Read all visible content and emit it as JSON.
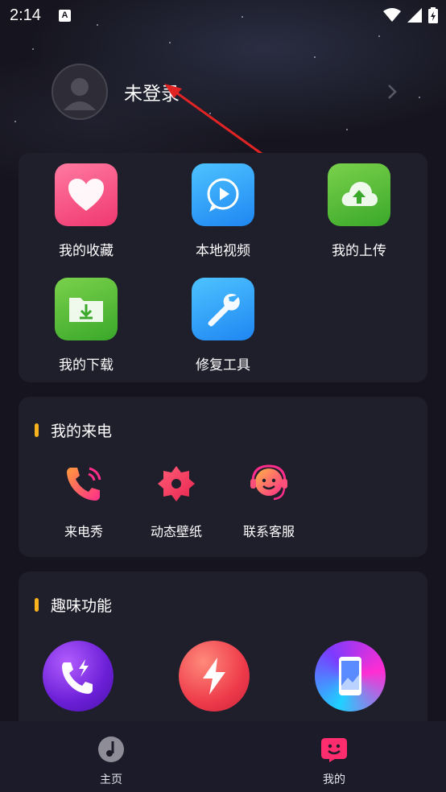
{
  "status_bar": {
    "time": "2:14",
    "notification_letter": "A"
  },
  "profile": {
    "name": "未登录"
  },
  "tools": [
    {
      "label": "我的收藏",
      "icon": "heart-icon"
    },
    {
      "label": "本地视频",
      "icon": "play-chat-icon"
    },
    {
      "label": "我的上传",
      "icon": "cloud-upload-icon"
    },
    {
      "label": "我的下载",
      "icon": "folder-download-icon"
    },
    {
      "label": "修复工具",
      "icon": "wrench-icon"
    }
  ],
  "my_calls": {
    "title": "我的来电",
    "items": [
      {
        "label": "来电秀",
        "icon": "phone-ring-icon"
      },
      {
        "label": "动态壁纸",
        "icon": "flower-icon"
      },
      {
        "label": "联系客服",
        "icon": "headset-icon"
      }
    ]
  },
  "fun": {
    "title": "趣味功能",
    "items": [
      {
        "icon": "phone-flash-icon"
      },
      {
        "icon": "lightning-icon"
      },
      {
        "icon": "phone-wallpaper-icon"
      }
    ]
  },
  "bottom_nav": [
    {
      "label": "主页",
      "icon": "music-note-icon"
    },
    {
      "label": "我的",
      "icon": "smile-face-icon"
    }
  ],
  "colors": {
    "accent": "#f7b21e",
    "card": "#1f1e2b",
    "background": "#16151f",
    "nav_active": "#ff2d6e"
  }
}
